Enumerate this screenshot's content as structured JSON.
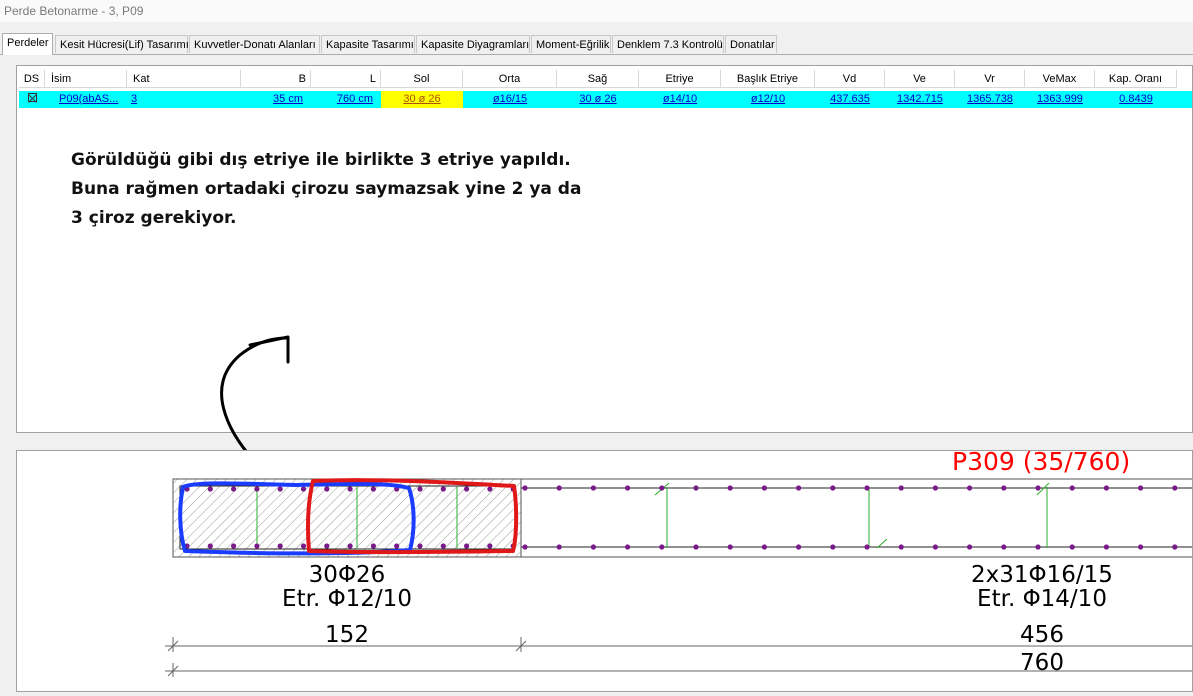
{
  "window": {
    "title": "Perde Betonarme - 3, P09"
  },
  "tabs": [
    {
      "label": "Perdeler",
      "active": true
    },
    {
      "label": "Kesit Hücresi(Lif) Tasarımı"
    },
    {
      "label": "Kuvvetler-Donatı Alanları"
    },
    {
      "label": "Kapasite Tasarımı"
    },
    {
      "label": "Kapasite Diyagramları"
    },
    {
      "label": "Moment-Eğrilik"
    },
    {
      "label": "Denklem 7.3 Kontrolü"
    },
    {
      "label": "Donatılar"
    }
  ],
  "table": {
    "columns": [
      "DS",
      "İsim",
      "Kat",
      "B",
      "L",
      "Sol",
      "Orta",
      "Sağ",
      "Etriye",
      "Başlık Etriye",
      "Vd",
      "Ve",
      "Vr",
      "VeMax",
      "Kap. Oranı"
    ],
    "row": {
      "isim": "P09(abAS...",
      "kat": "3",
      "b": "35 cm",
      "l": "760 cm",
      "sol": "30 ø 26",
      "orta": "ø16/15",
      "sag": "30 ø 26",
      "etriye": "ø14/10",
      "baslik_etriye": "ø12/10",
      "vd": "437.635",
      "ve": "1342.715",
      "vr": "1365.738",
      "vemax": "1363.999",
      "kap_orani": "0.8439"
    }
  },
  "annotation": {
    "line1": "Görüldüğü gibi dış etriye ile birlikte 3 etriye yapıldı.",
    "line2": "Buna rağmen ortadaki çirozu saymazsak yine 2 ya da",
    "line3": "3 çiroz gerekiyor."
  },
  "drawing": {
    "wall_label": "P309 (35/760)",
    "end_rebar": "30Φ26",
    "end_stirrup": "Etr. Φ12/10",
    "web_rebar": "2x31Φ16/15",
    "web_stirrup": "Etr. Φ14/10",
    "dim_end": "152",
    "dim_web": "456",
    "dim_total": "760",
    "colors": {
      "label_red": "#ff0000",
      "highlight_blue": "#1a3cff",
      "highlight_red": "#e01818",
      "bar_purple": "#7a1a8a",
      "tie_green": "#22aa22"
    }
  }
}
